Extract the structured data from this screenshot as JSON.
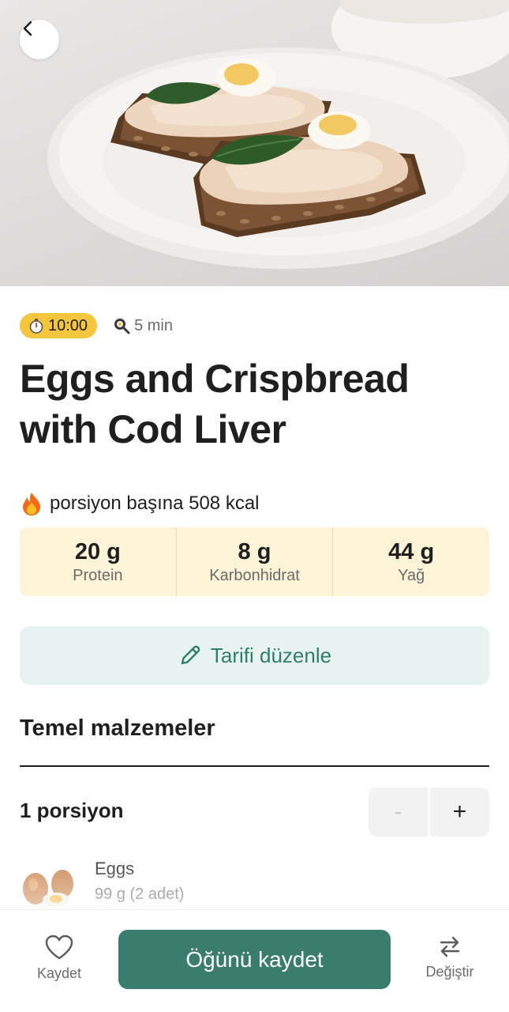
{
  "hero": {
    "image": "crispbread-with-cod-liver-and-eggs-photo"
  },
  "header": {
    "back_icon": "chevron-left-icon"
  },
  "meta": {
    "timer_icon": "stopwatch-icon",
    "timer_text": "10:00",
    "cook_icon": "frying-pan-icon",
    "cook_time": "5 min"
  },
  "recipe": {
    "title": "Eggs and Crispbread with Cod Liver",
    "kcal_icon": "fire-icon",
    "kcal_text": "porsiyon başına 508 kcal"
  },
  "macros": [
    {
      "value": "20 g",
      "label": "Protein"
    },
    {
      "value": "8 g",
      "label": "Karbonhidrat"
    },
    {
      "value": "44 g",
      "label": "Yağ"
    }
  ],
  "edit": {
    "icon": "pencil-icon",
    "label": "Tarifi düzenle"
  },
  "ingredients_section": {
    "title": "Temel malzemeler",
    "portion_label": "1 porsiyon",
    "minus": "-",
    "plus": "+",
    "items": [
      {
        "name": "Eggs",
        "amount": "99 g (2 adet)",
        "icon": "eggs-image"
      }
    ]
  },
  "bottom_bar": {
    "save_icon": "heart-icon",
    "save_label": "Kaydet",
    "primary_label": "Öğünü kaydet",
    "swap_icon": "swap-arrows-icon",
    "swap_label": "Değiştir"
  },
  "colors": {
    "accent": "#3a7d6e",
    "timer_badge": "#f4c63d",
    "macro_bg": "#fdf3d6",
    "edit_bg": "#e8f3f1"
  }
}
